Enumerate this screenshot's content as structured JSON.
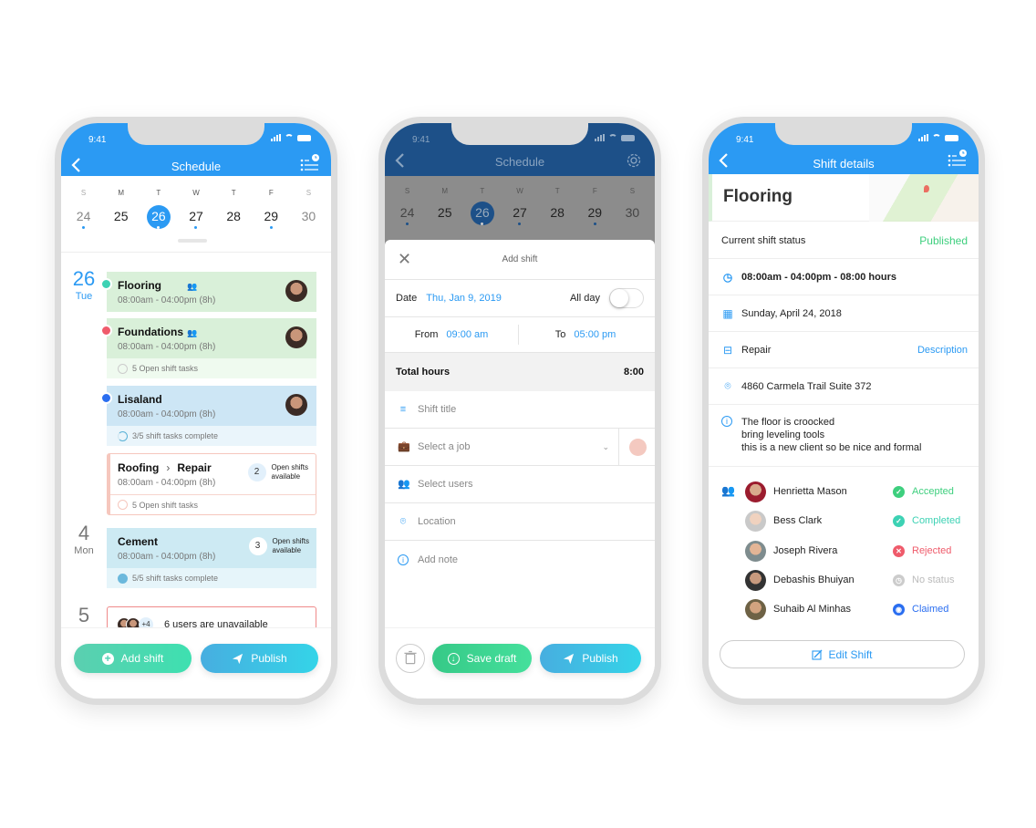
{
  "status_bar": {
    "time": "9:41"
  },
  "colors": {
    "primary": "#2b9af3",
    "accepted": "#3ecf7e",
    "completed": "#3dd2b4",
    "rejected": "#ef5b6b",
    "no_status": "#cccccc",
    "claimed": "#2a6ef0"
  },
  "calendar": {
    "weekdays": [
      "S",
      "M",
      "T",
      "W",
      "T",
      "F",
      "S"
    ],
    "days": [
      "24",
      "25",
      "26",
      "27",
      "28",
      "29",
      "30"
    ],
    "selected": "26"
  },
  "schedule": {
    "title": "Schedule",
    "groups": [
      {
        "date": "26",
        "day": "Tue"
      },
      {
        "date": "4",
        "day": "Mon"
      },
      {
        "date": "5",
        "day": ""
      }
    ],
    "shifts": [
      {
        "title": "Flooring",
        "hours": "08:00am - 04:00pm (8h)",
        "status": "accepted"
      },
      {
        "title": "Foundations",
        "hours": "08:00am - 04:00pm (8h)",
        "status": "rejected",
        "tasks": "5 Open shift tasks"
      },
      {
        "title": "Lisaland",
        "hours": "08:00am - 04:00pm (8h)",
        "status": "claimed",
        "tasks": "3/5 shift tasks complete"
      },
      {
        "title": "Roofing",
        "subtitle": "Repair",
        "hours": "08:00am - 04:00pm (8h)",
        "open_count": "2",
        "open_label_1": "Open shifts",
        "open_label_2": "available",
        "tasks": "5 Open shift tasks"
      },
      {
        "title": "Cement",
        "hours": "08:00am - 04:00pm (8h)",
        "open_count": "3",
        "open_label_1": "Open shifts",
        "open_label_2": "available",
        "tasks": "5/5 shift tasks complete"
      }
    ],
    "unavailable": {
      "extra": "+4",
      "text": "6 users are unavailable"
    },
    "add_shift": "Add shift",
    "publish": "Publish"
  },
  "add_shift": {
    "nav_title": "Schedule",
    "title": "Add shift",
    "date_label": "Date",
    "date_value": "Thu, Jan 9, 2019",
    "all_day_label": "All day",
    "all_day": false,
    "from_label": "From",
    "from_value": "09:00 am",
    "to_label": "To",
    "to_value": "05:00 pm",
    "total_label": "Total hours",
    "total_value": "8:00",
    "fields": {
      "shift_title": "Shift title",
      "job": "Select a job",
      "users": "Select users",
      "location": "Location",
      "note": "Add note"
    },
    "save_draft": "Save draft",
    "publish": "Publish"
  },
  "shift_details": {
    "nav_title": "Shift details",
    "title": "Flooring",
    "status_label": "Current shift status",
    "status_value": "Published",
    "time": "08:00am - 04:00pm - 08:00 hours",
    "date": "Sunday, April 24, 2018",
    "job": "Repair",
    "job_link": "Description",
    "address": "4860 Carmela Trail Suite 372",
    "note_lines": [
      "The floor is croocked",
      "bring leveling tools",
      "this is a new client so be nice and formal"
    ],
    "members": [
      {
        "name": "Henrietta Mason",
        "status": "Accepted"
      },
      {
        "name": "Bess Clark",
        "status": "Completed"
      },
      {
        "name": "Joseph Rivera",
        "status": "Rejected"
      },
      {
        "name": "Debashis Bhuiyan",
        "status": "No status"
      },
      {
        "name": "Suhaib Al Minhas",
        "status": "Claimed"
      }
    ],
    "edit_button": "Edit Shift"
  }
}
